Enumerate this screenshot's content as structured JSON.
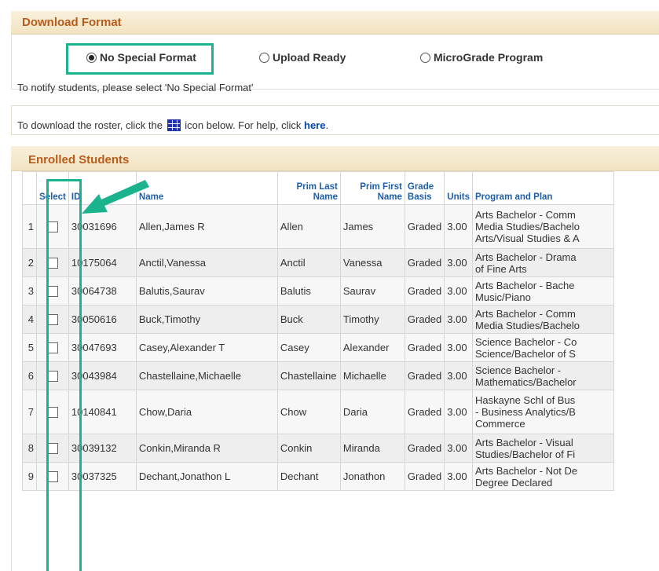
{
  "download_format": {
    "title": "Download Format",
    "options": [
      {
        "label": "No Special Format",
        "selected": true
      },
      {
        "label": "Upload Ready",
        "selected": false
      },
      {
        "label": "MicroGrade Program",
        "selected": false
      }
    ],
    "notify_text": "To notify students, please select 'No Special Format'"
  },
  "help": {
    "text_before": "To download the roster, click the",
    "text_after": "icon below. For help, click",
    "link": "here",
    "period": "."
  },
  "enrolled": {
    "title": "Enrolled Students",
    "columns": [
      "",
      "Select",
      "ID",
      "Name",
      "Prim Last Name",
      "Prim First Name",
      "Grade Basis",
      "Units",
      "Program and Plan"
    ],
    "rows": [
      {
        "n": "1",
        "id": "30031696",
        "name": "Allen,James R",
        "last": "Allen",
        "first": "James",
        "basis": "Graded",
        "units": "3.00",
        "plan": [
          "Arts Bachelor - Comm",
          "Media Studies/Bachelo",
          "Arts/Visual Studies & A"
        ]
      },
      {
        "n": "2",
        "id": "10175064",
        "name": "Anctil,Vanessa",
        "last": "Anctil",
        "first": "Vanessa",
        "basis": "Graded",
        "units": "3.00",
        "plan": [
          "Arts Bachelor - Drama",
          "of Fine Arts"
        ]
      },
      {
        "n": "3",
        "id": "30064738",
        "name": "Balutis,Saurav",
        "last": "Balutis",
        "first": "Saurav",
        "basis": "Graded",
        "units": "3.00",
        "plan": [
          "Arts Bachelor - Bache",
          "Music/Piano"
        ]
      },
      {
        "n": "4",
        "id": "30050616",
        "name": "Buck,Timothy",
        "last": "Buck",
        "first": "Timothy",
        "basis": "Graded",
        "units": "3.00",
        "plan": [
          "Arts Bachelor - Comm",
          "Media Studies/Bachelo"
        ]
      },
      {
        "n": "5",
        "id": "30047693",
        "name": "Casey,Alexander T",
        "last": "Casey",
        "first": "Alexander",
        "basis": "Graded",
        "units": "3.00",
        "plan": [
          "Science Bachelor - Co",
          "Science/Bachelor of S"
        ]
      },
      {
        "n": "6",
        "id": "30043984",
        "name": "Chastellaine,Michaelle",
        "last": "Chastellaine",
        "first": "Michaelle",
        "basis": "Graded",
        "units": "3.00",
        "plan": [
          "Science Bachelor -",
          "Mathematics/Bachelor"
        ]
      },
      {
        "n": "7",
        "id": "10140841",
        "name": "Chow,Daria",
        "last": "Chow",
        "first": "Daria",
        "basis": "Graded",
        "units": "3.00",
        "plan": [
          "Haskayne Schl of Bus",
          "- Business Analytics/B",
          "Commerce"
        ]
      },
      {
        "n": "8",
        "id": "30039132",
        "name": "Conkin,Miranda R",
        "last": "Conkin",
        "first": "Miranda",
        "basis": "Graded",
        "units": "3.00",
        "plan": [
          "Arts Bachelor - Visual",
          "Studies/Bachelor of Fi"
        ]
      },
      {
        "n": "9",
        "id": "30037325",
        "name": "Dechant,Jonathon L",
        "last": "Dechant",
        "first": "Jonathon",
        "basis": "Graded",
        "units": "3.00",
        "plan": [
          "Arts Bachelor - Not De",
          "Degree Declared"
        ]
      }
    ]
  },
  "colors": {
    "highlight": "#1bb38e",
    "section_title": "#b85c1b",
    "header_text": "#1f5ea8",
    "link": "#0645ad"
  },
  "icons": {
    "radio": "radio-button",
    "download": "grid-download-icon",
    "arrow": "annotation-arrow"
  }
}
